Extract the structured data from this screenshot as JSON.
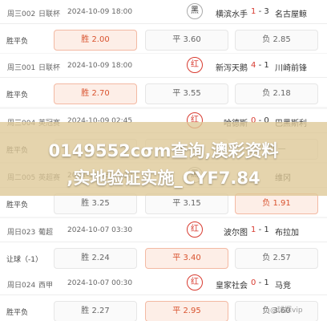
{
  "cards": [
    {
      "code": "周三002",
      "league": "日联杯",
      "time": "2024-10-09 18:00",
      "rec": "黑",
      "rec_color": "black",
      "home": "横滨水手",
      "home_score": "1",
      "sep": "-",
      "away_score": "3",
      "away": "名古屋鲸",
      "odds_type": "胜平负",
      "win": "胜 2.00",
      "draw": "平 3.60",
      "lose": "负 2.85",
      "selected": "win"
    },
    {
      "code": "周三001",
      "league": "日联杯",
      "time": "2024-10-09 18:00",
      "rec": "红",
      "rec_color": "red",
      "home": "新泻天鹅",
      "home_score": "4",
      "sep": "-",
      "away_score": "1",
      "away": "川崎前锋",
      "odds_type": "胜平负",
      "win": "胜 2.70",
      "draw": "平 3.55",
      "lose": "负 2.18",
      "selected": "win"
    },
    {
      "code": "周三004",
      "league": "英冠赛",
      "time": "2024-10-09 02:45",
      "rec": "红",
      "rec_color": "red",
      "home": "哈德斯",
      "home_score": "0",
      "sep": "-",
      "away_score": "0",
      "away": "巴黑斯利",
      "odds_type": "胜平负",
      "win": "胜 —",
      "draw": "平 —",
      "lose": "负 —",
      "selected": "none"
    },
    {
      "code": "周二005",
      "league": "英超赛",
      "time": "2024-10-08 03:00",
      "rec": "黑",
      "rec_color": "black",
      "home": "",
      "home_score": "",
      "sep": "",
      "away_score": "",
      "away": "维冈",
      "odds_type": "胜平负",
      "win": "胜 3.25",
      "draw": "平 3.15",
      "lose": "负 1.91",
      "selected": "lose"
    },
    {
      "code": "周日023",
      "league": "葡超",
      "time": "2024-10-07 03:30",
      "rec": "红",
      "rec_color": "red",
      "home": "波尔图",
      "home_score": "1",
      "sep": "-",
      "away_score": "1",
      "away": "布拉加",
      "odds_type": "让球（-1）",
      "win": "胜 2.24",
      "draw": "平 3.40",
      "lose": "负 2.57",
      "selected": "draw"
    },
    {
      "code": "周日024",
      "league": "西甲",
      "time": "2024-10-07 00:30",
      "rec": "红",
      "rec_color": "red",
      "home": "皇家社会",
      "home_score": "0",
      "sep": "-",
      "away_score": "1",
      "away": "马竞",
      "odds_type": "胜平负",
      "win": "胜 2.27",
      "draw": "平 2.95",
      "lose": "负 3.60",
      "selected": "draw"
    }
  ],
  "overlay": {
    "line1": "0149552cσm查询,澳彩资料",
    "line2": ",实地验证实施_CYF7.84"
  },
  "watermark": "@球探vip"
}
